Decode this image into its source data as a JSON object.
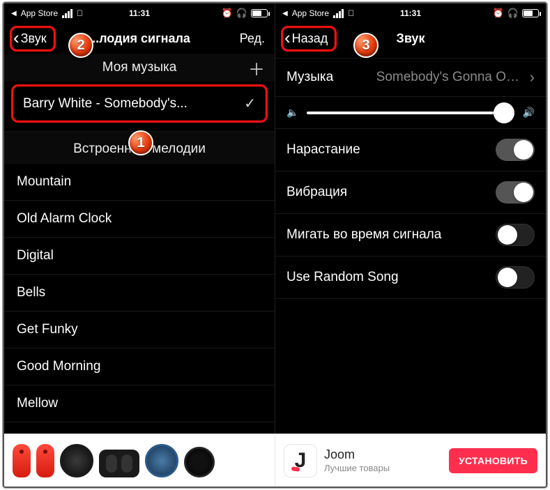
{
  "statusbar": {
    "back_app": "App Store",
    "time": "11:31"
  },
  "left": {
    "back_label": "Звук",
    "title": "...лодия сигнала",
    "edit_label": "Ред.",
    "my_music_header": "Моя музыка",
    "selected_track": "Barry White -  Somebody's...",
    "builtin_header": "Встроенные мелодии",
    "builtin": [
      "Mountain",
      "Old Alarm Clock",
      "Digital",
      "Bells",
      "Get Funky",
      "Good Morning",
      "Mellow"
    ]
  },
  "right": {
    "back_label": "Назад",
    "title": "Звук",
    "music_label": "Музыка",
    "music_value": "Somebody's Gonna Off...",
    "rows": {
      "fade_in": "Нарастание",
      "vibration": "Вибрация",
      "flash": "Мигать во время сигнала",
      "random": "Use Random Song"
    },
    "toggles": {
      "fade_in": true,
      "vibration": true,
      "flash": false,
      "random": false
    }
  },
  "badges": {
    "b1": "1",
    "b2": "2",
    "b3": "3"
  },
  "ads": {
    "joom_title": "Joom",
    "joom_sub": "Лучшие товары",
    "install": "УСТАНОВИТЬ"
  }
}
